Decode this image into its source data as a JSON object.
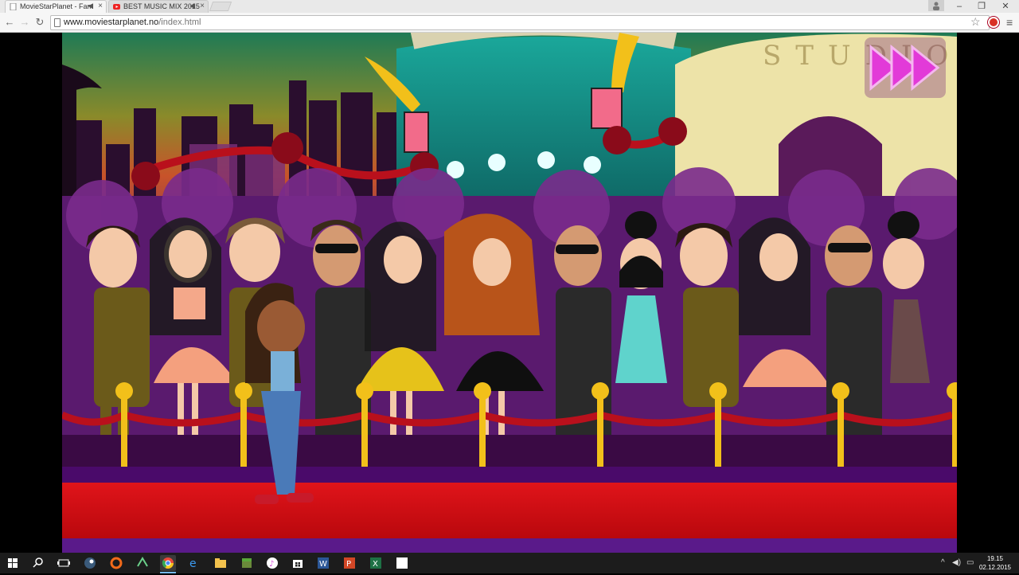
{
  "browser": {
    "tabs": [
      {
        "title": "MovieStarPlanet - Fam",
        "favicon": "page-icon",
        "active": true
      },
      {
        "title": "BEST MUSIC MIX 2015",
        "favicon": "youtube-icon",
        "active": false
      }
    ],
    "url_domain": "www.moviestarplanet.no",
    "url_path": "/index.html",
    "window_controls": [
      "minimize-icon",
      "restore-icon",
      "close-icon"
    ]
  },
  "game": {
    "sign_text": "STUDIO",
    "skip_button_icon": "fast-forward-icon"
  },
  "taskbar": {
    "items": [
      "windows-start-icon",
      "search-icon",
      "task-view-icon",
      "steam-icon",
      "origin-icon",
      "app-icon",
      "chrome-icon",
      "edge-icon",
      "file-explorer-icon",
      "minecraft-icon",
      "itunes-icon",
      "store-icon",
      "word-icon",
      "powerpoint-icon",
      "excel-icon",
      "blank-window-icon"
    ],
    "time": "19.15",
    "date": "02.12.2015"
  },
  "colors": {
    "carpet": "#d40b10",
    "rope": "#c0101e",
    "stanchion": "#f2c01a",
    "crowd_bg": "#5a1a6e",
    "sky_top": "#25805a"
  }
}
